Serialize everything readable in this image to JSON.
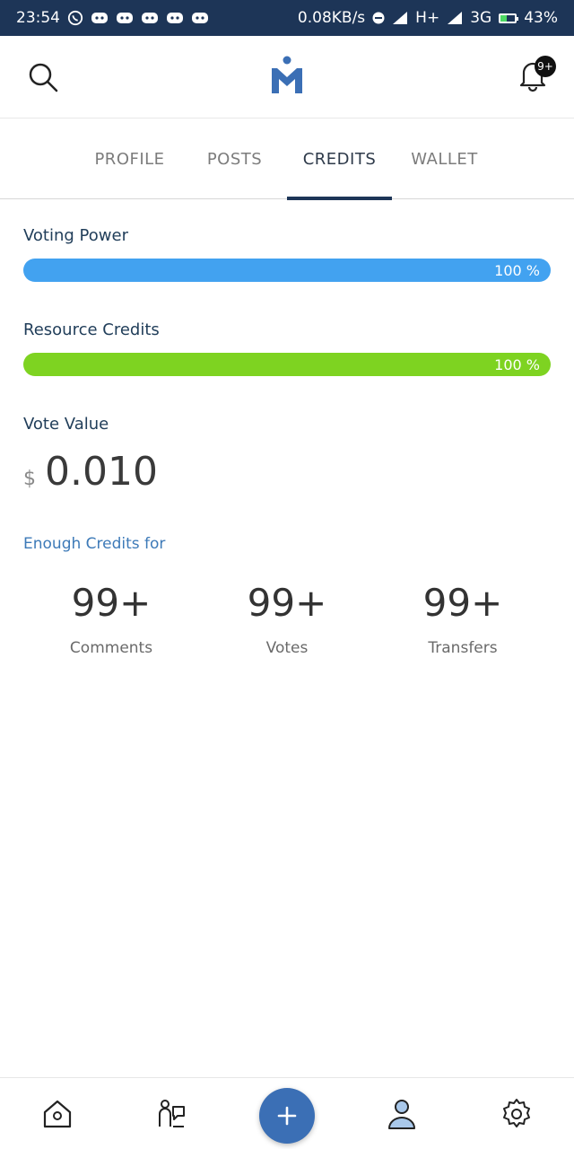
{
  "status_bar": {
    "time": "23:54",
    "network_speed": "0.08KB/s",
    "signal_label": "H+",
    "carrier": "3G",
    "battery": "43%"
  },
  "header": {
    "logo_name": "app-logo",
    "notifications_badge": "9+"
  },
  "tabs": [
    {
      "label": "PROFILE",
      "active": false
    },
    {
      "label": "POSTS",
      "active": false
    },
    {
      "label": "CREDITS",
      "active": true
    },
    {
      "label": "WALLET",
      "active": false
    }
  ],
  "credits": {
    "voting_power": {
      "label": "Voting Power",
      "value_text": "100 %",
      "fraction": 1.0,
      "color": "#42a2f0"
    },
    "resource_credits": {
      "label": "Resource Credits",
      "value_text": "100 %",
      "fraction": 1.0,
      "color": "#7ed321"
    },
    "vote_value": {
      "label": "Vote Value",
      "currency": "$",
      "amount": "0.010"
    },
    "enough_label": "Enough Credits for",
    "stats": [
      {
        "value": "99+",
        "label": "Comments"
      },
      {
        "value": "99+",
        "label": "Votes"
      },
      {
        "value": "99+",
        "label": "Transfers"
      }
    ]
  },
  "bottom_nav": [
    {
      "icon": "home-icon"
    },
    {
      "icon": "community-icon"
    },
    {
      "icon": "add-icon"
    },
    {
      "icon": "profile-icon"
    },
    {
      "icon": "settings-icon"
    }
  ],
  "colors": {
    "status_bar": "#1d3557",
    "accent": "#3b6fb5"
  }
}
